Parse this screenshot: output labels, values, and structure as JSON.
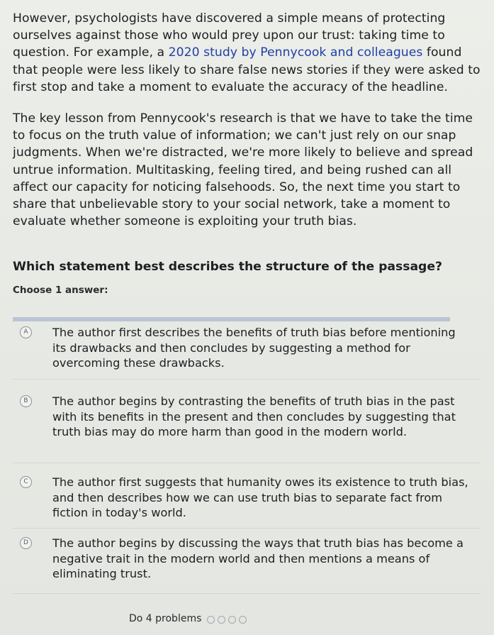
{
  "passage": {
    "p1_a": "However, psychologists have discovered a simple means of protecting ourselves against those who would prey upon our trust: taking time to question. For example, a ",
    "p1_link": "2020 study by Pennycook and colleagues",
    "p1_b": " found that people were less likely to share false news stories if they were asked to first stop and take a moment to evaluate the accuracy of the headline.",
    "p2": "The key lesson from Pennycook's research is that we have to take the time to focus on the truth value of information; we can't just rely on our snap judgments. When we're distracted, we're more likely to believe and spread untrue information. Multitasking, feeling tired, and being rushed can all affect our capacity for noticing falsehoods. So, the next time you start to share that unbelievable story to your social network, take a moment to evaluate whether someone is exploiting your truth bias."
  },
  "question": "Which statement best describes the structure of the passage?",
  "choose_label": "Choose 1 answer:",
  "options": [
    {
      "letter": "A",
      "text": "The author first describes the benefits of truth bias before mentioning its drawbacks and then concludes by suggesting a method for overcoming these drawbacks."
    },
    {
      "letter": "B",
      "text": "The author begins by contrasting the benefits of truth bias in the past with its benefits in the present and then concludes by suggesting that truth bias may do more harm than good in the modern world."
    },
    {
      "letter": "C",
      "text": "The author first suggests that humanity owes its existence to truth bias, and then describes how we can use truth bias to separate fact from fiction in today's world."
    },
    {
      "letter": "D",
      "text": "The author begins by discussing the ways that truth bias has become a negative trait in the modern world and then mentions a means of eliminating trust."
    }
  ],
  "footer": {
    "label": "Do 4 problems",
    "progress_total": 4,
    "progress_done": 0
  }
}
